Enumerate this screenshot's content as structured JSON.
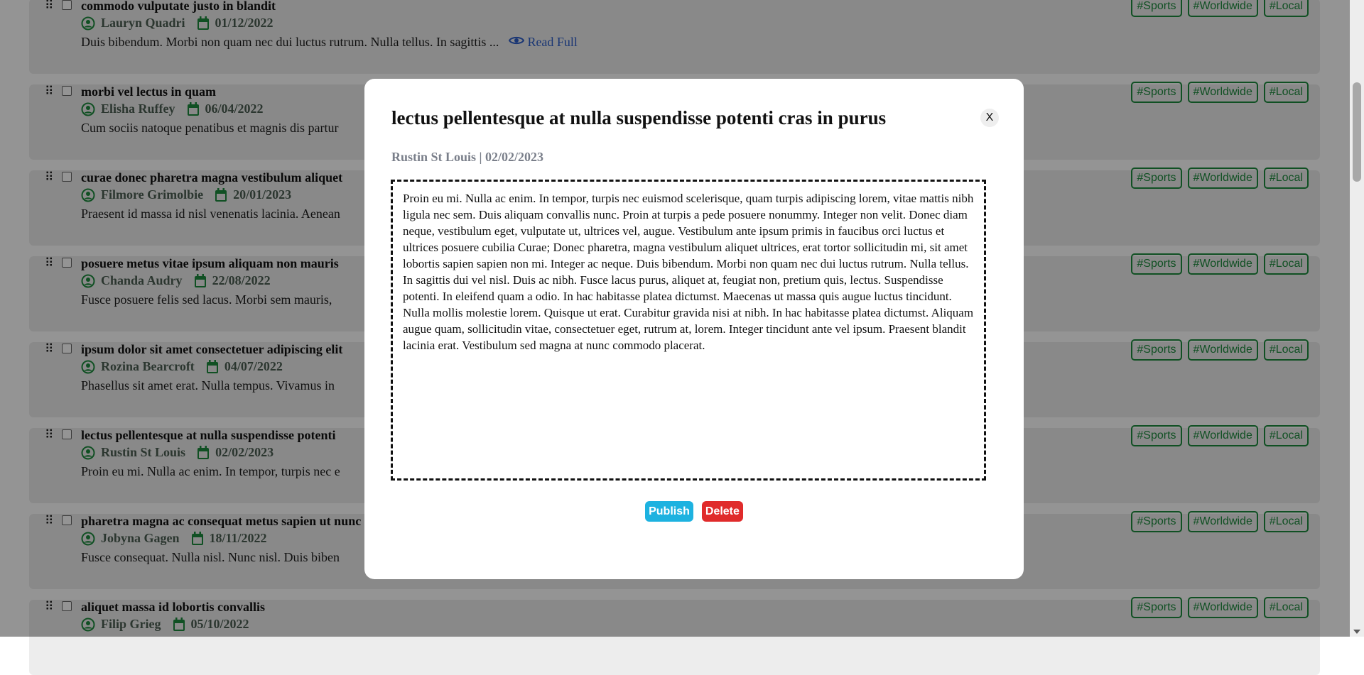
{
  "colors": {
    "tag": "#1d8a3d",
    "icon_green": "#1d8a3d",
    "readfull": "#2d5ec9",
    "publish": "#1db2e0",
    "delete": "#e02b2b",
    "overlay": "rgba(0,0,0,0.42)"
  },
  "icons": {
    "drag": "drag-handle-icon",
    "author": "user-circle-icon",
    "date": "calendar-icon",
    "read": "eye-icon"
  },
  "drag_glyph": "⠿",
  "tags": [
    "#Sports",
    "#Worldwide",
    "#Local"
  ],
  "read_full_label": "Read Full",
  "articles": [
    {
      "title": "commodo vulputate justo in blandit",
      "author": "Lauryn Quadri",
      "date": "01/12/2022",
      "excerpt": "Duis bibendum. Morbi non quam nec dui luctus rutrum. Nulla tellus. In sagittis ..."
    },
    {
      "title": "morbi vel lectus in quam",
      "author": "Elisha Ruffey",
      "date": "06/04/2022",
      "excerpt": "Cum sociis natoque penatibus et magnis dis partur"
    },
    {
      "title": "curae donec pharetra magna vestibulum aliquet",
      "author": "Filmore Grimolbie",
      "date": "20/01/2023",
      "excerpt": "Praesent id massa id nisl venenatis lacinia. Aenean"
    },
    {
      "title": "posuere metus vitae ipsum aliquam non mauris",
      "author": "Chanda Audry",
      "date": "22/08/2022",
      "excerpt": "Fusce posuere felis sed lacus. Morbi sem mauris,"
    },
    {
      "title": "ipsum dolor sit amet consectetuer adipiscing elit",
      "author": "Rozina Bearcroft",
      "date": "04/07/2022",
      "excerpt": "Phasellus sit amet erat. Nulla tempus. Vivamus in"
    },
    {
      "title": "lectus pellentesque at nulla suspendisse potenti",
      "author": "Rustin St Louis",
      "date": "02/02/2023",
      "excerpt": "Proin eu mi. Nulla ac enim. In tempor, turpis nec e"
    },
    {
      "title": "pharetra magna ac consequat metus sapien ut nunc",
      "author": "Jobyna Gagen",
      "date": "18/11/2022",
      "excerpt": "Fusce consequat. Nulla nisl. Nunc nisl. Duis biben"
    },
    {
      "title": "aliquet massa id lobortis convallis",
      "author": "Filip Grieg",
      "date": "05/10/2022",
      "excerpt": ""
    }
  ],
  "modal": {
    "title": "lectus pellentesque at nulla suspendisse potenti cras in purus",
    "close_label": "X",
    "meta": "Rustin St Louis | 02/02/2023",
    "body": "Proin eu mi. Nulla ac enim. In tempor, turpis nec euismod scelerisque, quam turpis adipiscing lorem, vitae mattis nibh ligula nec sem. Duis aliquam convallis nunc. Proin at turpis a pede posuere nonummy. Integer non velit. Donec diam neque, vestibulum eget, vulputate ut, ultrices vel, augue. Vestibulum ante ipsum primis in faucibus orci luctus et ultrices posuere cubilia Curae; Donec pharetra, magna vestibulum aliquet ultrices, erat tortor sollicitudin mi, sit amet lobortis sapien sapien non mi. Integer ac neque. Duis bibendum. Morbi non quam nec dui luctus rutrum. Nulla tellus. In sagittis dui vel nisl. Duis ac nibh. Fusce lacus purus, aliquet at, feugiat non, pretium quis, lectus. Suspendisse potenti. In eleifend quam a odio. In hac habitasse platea dictumst. Maecenas ut massa quis augue luctus tincidunt. Nulla mollis molestie lorem. Quisque ut erat. Curabitur gravida nisi at nibh. In hac habitasse platea dictumst. Aliquam augue quam, sollicitudin vitae, consectetuer eget, rutrum at, lorem. Integer tincidunt ante vel ipsum. Praesent blandit lacinia erat. Vestibulum sed magna at nunc commodo placerat.",
    "publish_label": "Publish",
    "delete_label": "Delete"
  }
}
